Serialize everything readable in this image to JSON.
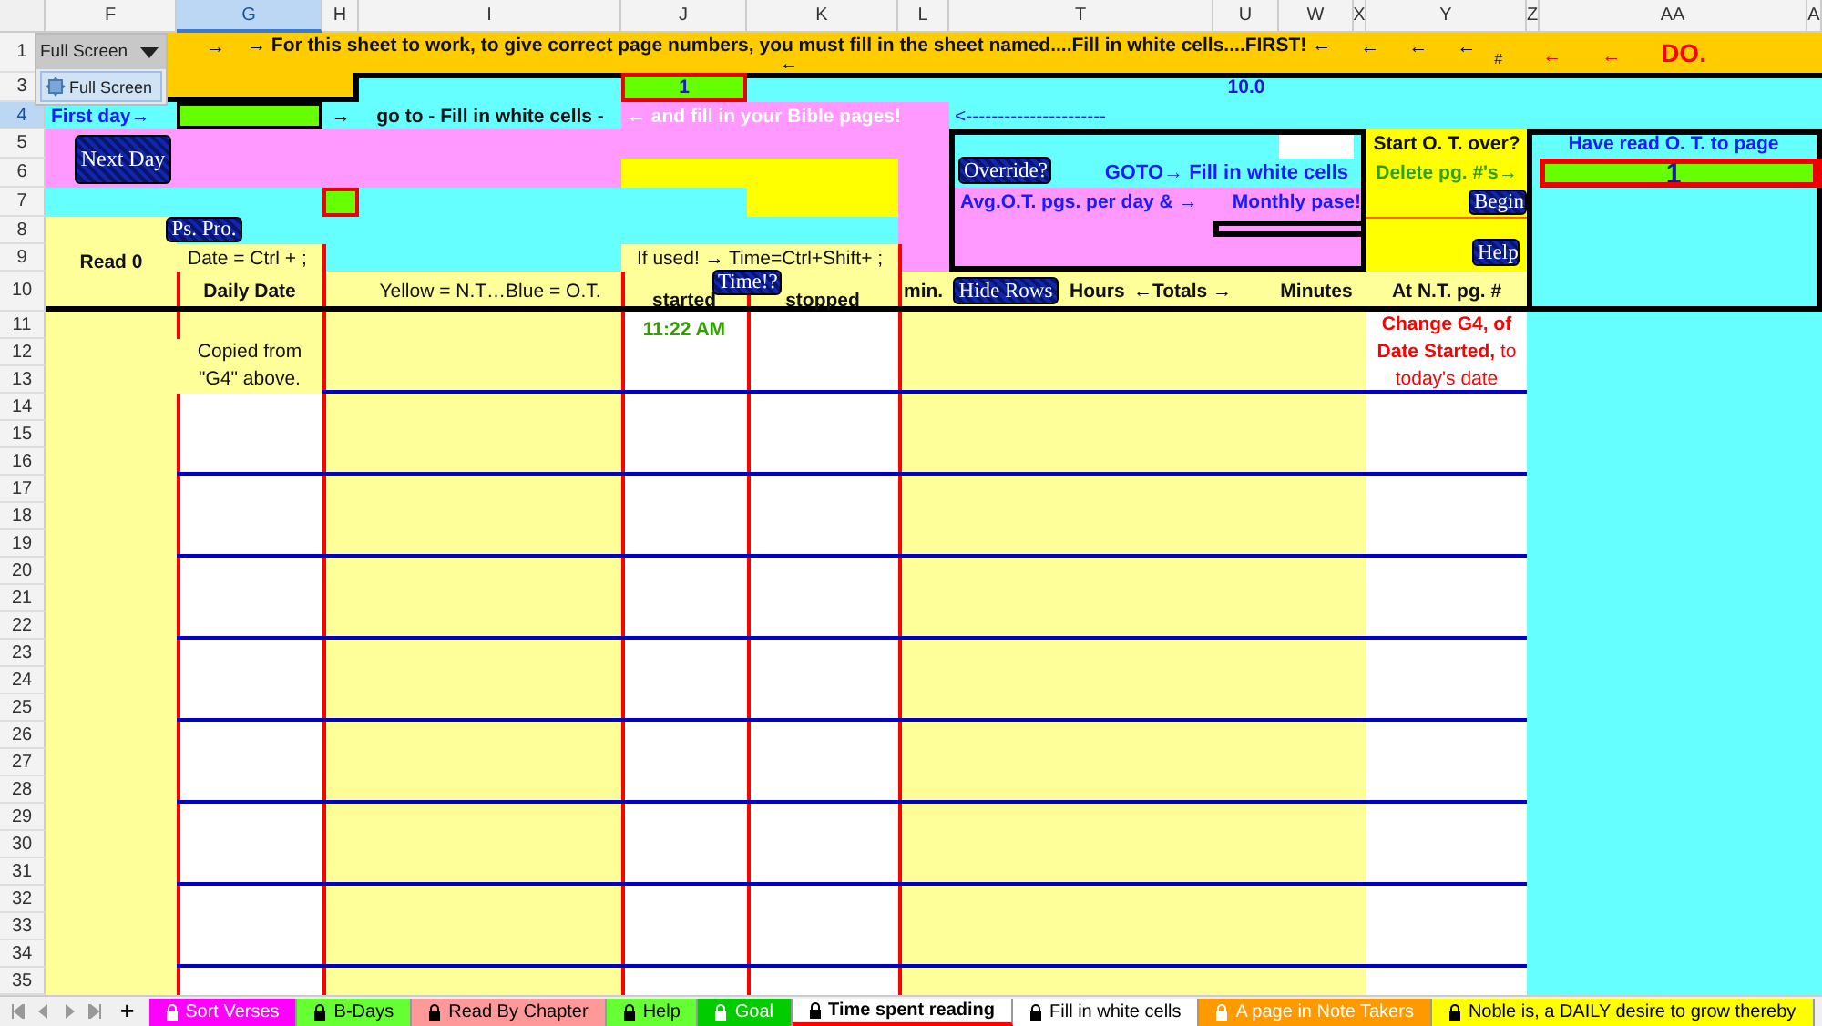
{
  "full_screen_toolbar": {
    "title": "Full Screen",
    "button": "Full Screen"
  },
  "column_headers": [
    {
      "label": "F",
      "selected": false
    },
    {
      "label": "G",
      "selected": true
    },
    {
      "label": "H",
      "selected": false
    },
    {
      "label": "I",
      "selected": false
    },
    {
      "label": "J",
      "selected": false
    },
    {
      "label": "K",
      "selected": false
    },
    {
      "label": "L",
      "selected": false
    },
    {
      "label": "T",
      "selected": false
    },
    {
      "label": "U",
      "selected": false
    },
    {
      "label": "W",
      "selected": false
    },
    {
      "label": "X",
      "selected": false
    },
    {
      "label": "Y",
      "selected": false
    },
    {
      "label": "Z",
      "selected": false
    },
    {
      "label": "AA",
      "selected": false
    },
    {
      "label": "A",
      "selected": false
    }
  ],
  "row_headers": [
    {
      "label": "1",
      "selected": false
    },
    {
      "label": "3",
      "selected": false
    },
    {
      "label": "4",
      "selected": true
    },
    {
      "label": "5",
      "selected": false
    },
    {
      "label": "6",
      "selected": false
    },
    {
      "label": "7",
      "selected": false
    },
    {
      "label": "8",
      "selected": false
    },
    {
      "label": "9",
      "selected": false
    },
    {
      "label": "10",
      "selected": false
    },
    {
      "label": "11",
      "selected": false
    },
    {
      "label": "12",
      "selected": false
    },
    {
      "label": "13",
      "selected": false
    },
    {
      "label": "14",
      "selected": false
    },
    {
      "label": "15",
      "selected": false
    },
    {
      "label": "16",
      "selected": false
    },
    {
      "label": "17",
      "selected": false
    },
    {
      "label": "18",
      "selected": false
    },
    {
      "label": "19",
      "selected": false
    },
    {
      "label": "20",
      "selected": false
    },
    {
      "label": "21",
      "selected": false
    },
    {
      "label": "22",
      "selected": false
    },
    {
      "label": "23",
      "selected": false
    },
    {
      "label": "24",
      "selected": false
    },
    {
      "label": "25",
      "selected": false
    },
    {
      "label": "26",
      "selected": false
    },
    {
      "label": "27",
      "selected": false
    },
    {
      "label": "28",
      "selected": false
    },
    {
      "label": "29",
      "selected": false
    },
    {
      "label": "30",
      "selected": false
    },
    {
      "label": "31",
      "selected": false
    },
    {
      "label": "32",
      "selected": false
    },
    {
      "label": "33",
      "selected": false
    },
    {
      "label": "34",
      "selected": false
    },
    {
      "label": "35",
      "selected": false
    }
  ],
  "banner": {
    "lead": "→",
    "text": "→ For this sheet to work, to give correct page numbers, you must fill in the sheet named....Fill in white cells....FIRST! ←",
    "continuation": "←",
    "arrows": [
      "←",
      "←",
      "←"
    ],
    "mark": "#",
    "red_arrows": [
      "←",
      "←"
    ],
    "alert": "DO."
  },
  "cells": [
    "1",
    "10.0",
    "First day→",
    "→",
    "go to - Fill in white cells -",
    "← and fill in your Bible pages!",
    "<----------------------",
    "GOTO→ Fill in white cells",
    "Avg.O.T. pgs. per day & →",
    "Monthly pase!",
    "Start O. T. over?",
    "Delete pg. #'s→",
    "Have read O. T. to page",
    "1",
    "Read 0",
    "Date = Ctrl + ;",
    "If used! → Time=Ctrl+Shift+ ;",
    "Daily Date",
    "Yellow = N.T…Blue = O.T.",
    "started",
    "stopped",
    "min.",
    "Hours",
    "←Totals →",
    "Minutes",
    "At N.T. pg. #",
    "11:22 AM",
    "Copied from \"G4\" above.",
    "**Change G4, of Date Started,** to today's date"
  ],
  "buttons": [
    "Next Day",
    "Ps. Pro.",
    "Time!?",
    "Override?",
    "Hide Rows",
    "Begin",
    "Help"
  ],
  "add_sheet": "+",
  "tabs": [
    {
      "label": "Sort Verses",
      "color": "#ff00ff",
      "selected": false
    },
    {
      "label": "B-Days",
      "color": "#66ff33",
      "selected": false
    },
    {
      "label": "Read By Chapter",
      "color": "#ff9999",
      "selected": false
    },
    {
      "label": "Help",
      "color": "#66ff33",
      "selected": false
    },
    {
      "label": "Goal",
      "color": "#00cc00",
      "selected": false
    },
    {
      "label": "Time spent reading",
      "color": "#ffffff",
      "selected": true
    },
    {
      "label": "Fill in white cells",
      "color": "#ffffff",
      "selected": false
    },
    {
      "label": "A page in Note Takers",
      "color": "#ff9900",
      "selected": false
    },
    {
      "label": "Noble is, a DAILY desire to grow thereby",
      "color": "#ffff00",
      "selected": false
    }
  ]
}
